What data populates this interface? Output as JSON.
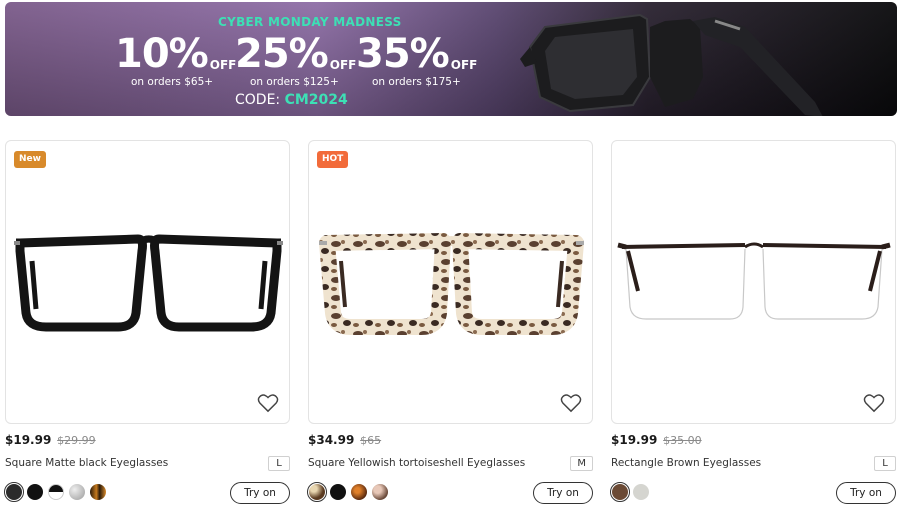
{
  "banner": {
    "headline": "CYBER MONDAY MADNESS",
    "offers": [
      {
        "percent": "10%",
        "off": "OFF",
        "condition": "on orders  $65+"
      },
      {
        "percent": "25%",
        "off": "OFF",
        "condition": "on orders  $125+"
      },
      {
        "percent": "35%",
        "off": "OFF",
        "condition": "on orders  $175+"
      }
    ],
    "code_label": "CODE: ",
    "code_value": "CM2024",
    "accent_color": "#3de0b5"
  },
  "products": [
    {
      "badge": "New",
      "price": "$19.99",
      "old_price": "$29.99",
      "name": "Square Matte black Eyeglasses",
      "size": "L",
      "try_on_label": "Try on",
      "swatches": [
        "#2b2b2b",
        "#111111",
        "#1a1a1a",
        "#b8b8b8",
        "#8a4a12"
      ]
    },
    {
      "badge": "HOT",
      "price": "$34.99",
      "old_price": "$65",
      "name": "Square Yellowish tortoiseshell Eyeglasses",
      "size": "M",
      "try_on_label": "Try on",
      "swatches": [
        "#7a5530",
        "#111111",
        "#9a4a1e",
        "#8a6a5a"
      ]
    },
    {
      "badge": "",
      "price": "$19.99",
      "old_price": "$35.00",
      "name": "Rectangle Brown Eyeglasses",
      "size": "L",
      "try_on_label": "Try on",
      "swatches": [
        "#6b4a35",
        "#d5d5d0"
      ]
    }
  ]
}
